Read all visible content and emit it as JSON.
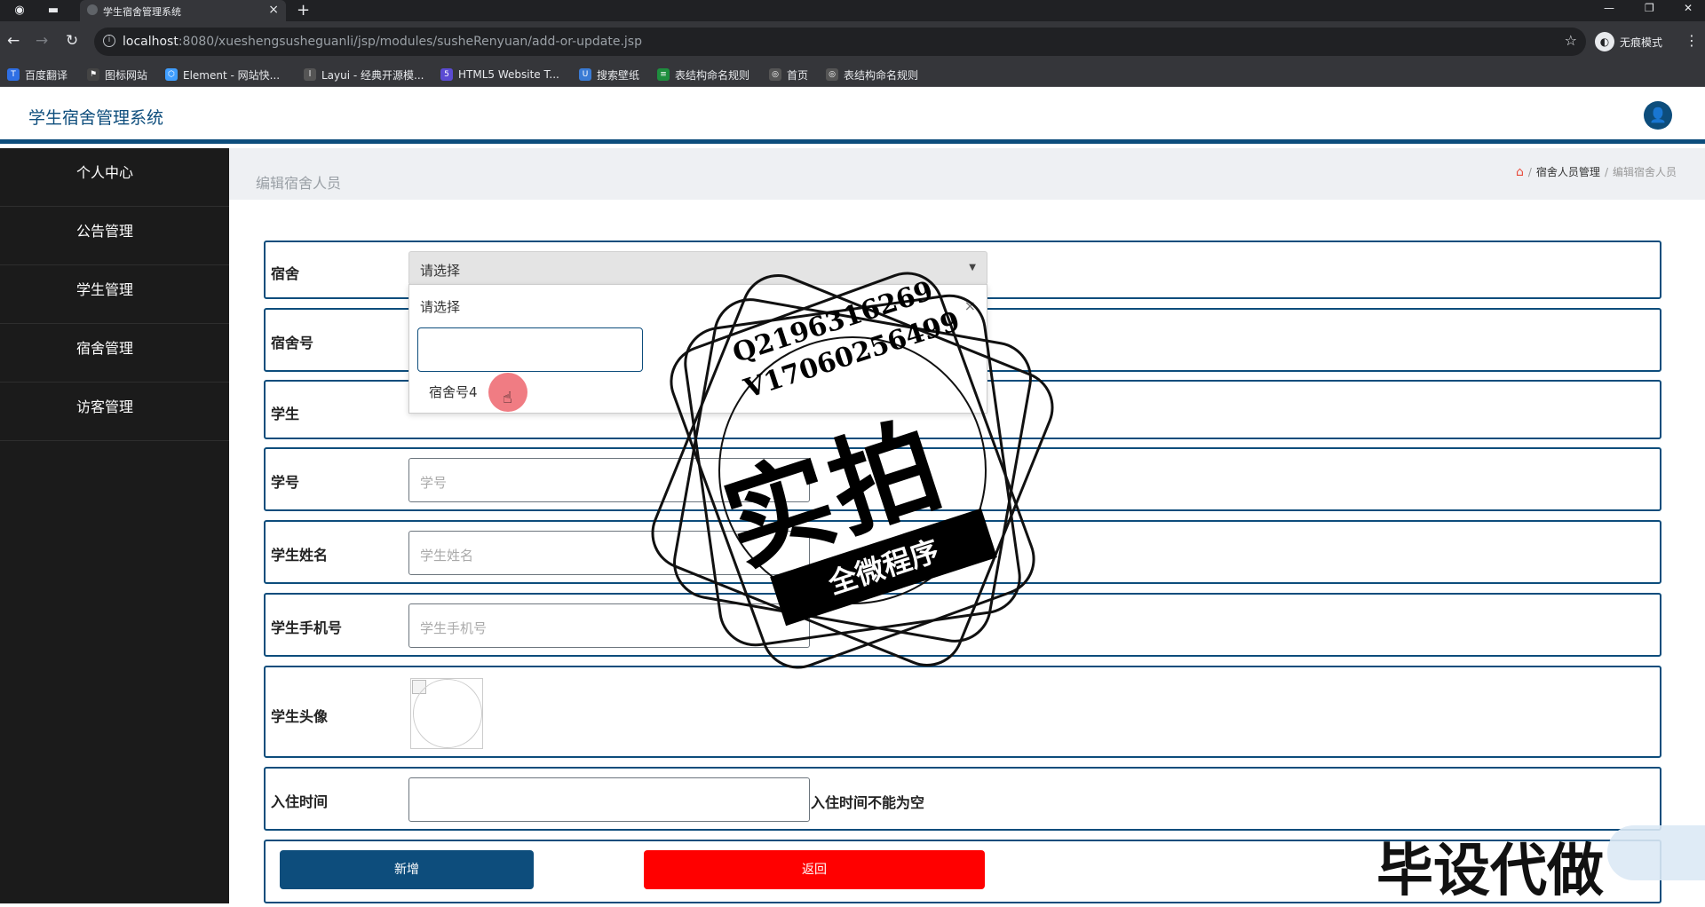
{
  "browser": {
    "tab_title": "学生宿舍管理系统",
    "url_host": "localhost",
    "url_rest": ":8080/xueshengsusheguanli/jsp/modules/susheRenyuan/add-or-update.jsp",
    "incognito_label": "无痕模式",
    "bookmarks": [
      {
        "label": "百度翻译",
        "icon": "baidu-translate-icon",
        "color": "#2f6fe4"
      },
      {
        "label": "图标网站",
        "icon": "flag-icon",
        "color": "#333333"
      },
      {
        "label": "Element - 网站快...",
        "icon": "element-icon",
        "color": "#409eff"
      },
      {
        "label": "Layui - 经典开源模...",
        "icon": "layui-icon",
        "color": "#555555"
      },
      {
        "label": "HTML5 Website T...",
        "icon": "html5-icon",
        "color": "#5b4bd3"
      },
      {
        "label": "搜索壁纸",
        "icon": "wallpaper-icon",
        "color": "#3a7bd5"
      },
      {
        "label": "表结构命名规则",
        "icon": "sheet-icon",
        "color": "#1e8e3e"
      },
      {
        "label": "首页",
        "icon": "globe-icon",
        "color": "#555555"
      },
      {
        "label": "表结构命名规则",
        "icon": "globe-icon",
        "color": "#555555"
      }
    ]
  },
  "app": {
    "title": "学生宿舍管理系统",
    "accent": "#0d4d7c"
  },
  "sidebar": {
    "items": [
      {
        "label": "个人中心"
      },
      {
        "label": "公告管理"
      },
      {
        "label": "学生管理"
      },
      {
        "label": "宿舍管理"
      },
      {
        "label": "访客管理"
      }
    ]
  },
  "breadcrumb": {
    "page_title": "编辑宿舍人员",
    "parent": "宿舍人员管理",
    "current": "编辑宿舍人员"
  },
  "form": {
    "sushe": {
      "label": "宿舍",
      "value": "请选择"
    },
    "dropdown": {
      "header": "请选择",
      "option": "宿舍号4"
    },
    "susheNumber": {
      "label": "宿舍号"
    },
    "student": {
      "label": "学生"
    },
    "studentNo": {
      "label": "学号",
      "placeholder": "学号"
    },
    "studentName": {
      "label": "学生姓名",
      "placeholder": "学生姓名"
    },
    "studentPhone": {
      "label": "学生手机号",
      "placeholder": "学生手机号"
    },
    "studentPhoto": {
      "label": "学生头像"
    },
    "checkinTime": {
      "label": "入住时间",
      "hint": "入住时间不能为空"
    },
    "buttons": {
      "submit": "新增",
      "back": "返回",
      "submit_color": "#0d4d7c",
      "back_color": "#ff0000"
    }
  },
  "watermark": {
    "line1": "Q2196316269",
    "line2": "V17060256499",
    "big": "实拍",
    "ribbon": "全微程序",
    "corner": "毕设代做"
  }
}
